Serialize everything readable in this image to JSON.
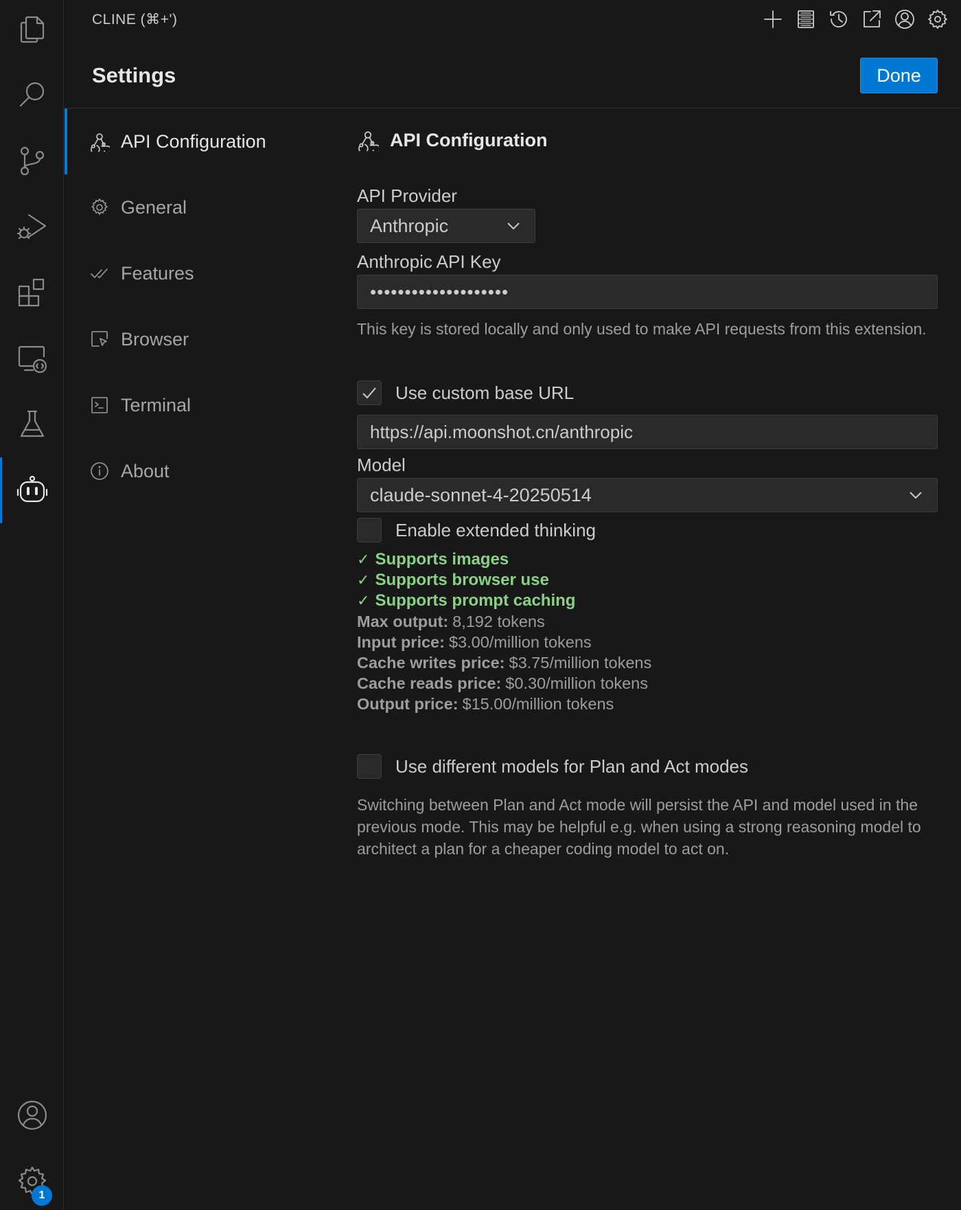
{
  "header": {
    "view_title": "CLINE (⌘+')",
    "settings_title": "Settings",
    "done_label": "Done"
  },
  "toolbar": {
    "icons": [
      "plus-icon",
      "server-icon",
      "history-icon",
      "popout-icon",
      "account-icon",
      "gear-icon"
    ]
  },
  "activity_bar": {
    "items": [
      "explorer-icon",
      "search-icon",
      "source-control-icon",
      "run-debug-icon",
      "extensions-icon",
      "remote-explorer-icon",
      "testing-icon",
      "cline-icon"
    ],
    "bottom": [
      "account-icon",
      "manage-gear-icon"
    ],
    "manage_badge": "1"
  },
  "nav": {
    "items": [
      {
        "label": "API Configuration",
        "icon": "webhook-icon",
        "active": true
      },
      {
        "label": "General",
        "icon": "gear-icon"
      },
      {
        "label": "Features",
        "icon": "check-all-icon"
      },
      {
        "label": "Browser",
        "icon": "browser-cursor-icon"
      },
      {
        "label": "Terminal",
        "icon": "terminal-icon"
      },
      {
        "label": "About",
        "icon": "info-icon"
      }
    ]
  },
  "main": {
    "section_title": "API Configuration",
    "api_provider_label": "API Provider",
    "api_provider_value": "Anthropic",
    "api_key_label": "Anthropic API Key",
    "api_key_value": "••••••••••••••••••••",
    "api_key_note": "This key is stored locally and only used to make API requests from this extension.",
    "custom_base_url_label": "Use custom base URL",
    "custom_base_url_checked": true,
    "base_url_value": "https://api.moonshot.cn/anthropic",
    "model_label": "Model",
    "model_value": "claude-sonnet-4-20250514",
    "extended_thinking_label": "Enable extended thinking",
    "extended_thinking_checked": false,
    "supports": [
      "Supports images",
      "Supports browser use",
      "Supports prompt caching"
    ],
    "info": [
      {
        "label": "Max output:",
        "value": "8,192 tokens"
      },
      {
        "label": "Input price:",
        "value": "$3.00/million tokens"
      },
      {
        "label": "Cache writes price:",
        "value": "$3.75/million tokens"
      },
      {
        "label": "Cache reads price:",
        "value": "$0.30/million tokens"
      },
      {
        "label": "Output price:",
        "value": "$15.00/million tokens"
      }
    ],
    "plan_act_label": "Use different models for Plan and Act modes",
    "plan_act_checked": false,
    "plan_act_note": "Switching between Plan and Act mode will persist the API and model used in the previous mode. This may be helpful e.g. when using a strong reasoning model to architect a plan for a cheaper coding model to act on."
  },
  "colors": {
    "accent": "#0078d4",
    "background": "#181818",
    "success": "#89d185"
  }
}
